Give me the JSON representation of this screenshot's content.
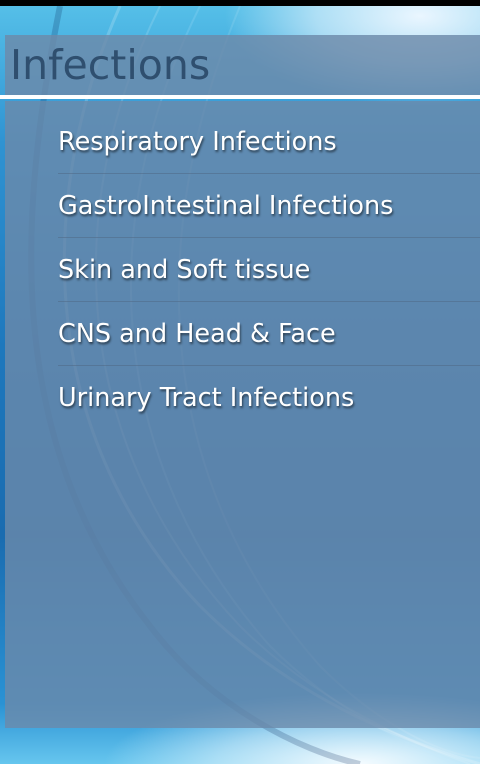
{
  "header": {
    "title": "Infections"
  },
  "menu": {
    "items": [
      {
        "label": "Respiratory Infections"
      },
      {
        "label": "GastroIntestinal Infections"
      },
      {
        "label": "Skin and Soft tissue"
      },
      {
        "label": "CNS and Head & Face"
      },
      {
        "label": "Urinary Tract Infections"
      }
    ]
  },
  "colors": {
    "panel": "#6C8AAA",
    "title_text": "#2F4F6F",
    "item_text": "#FFFFFF",
    "wallpaper_blue": "#1A6CB0"
  }
}
